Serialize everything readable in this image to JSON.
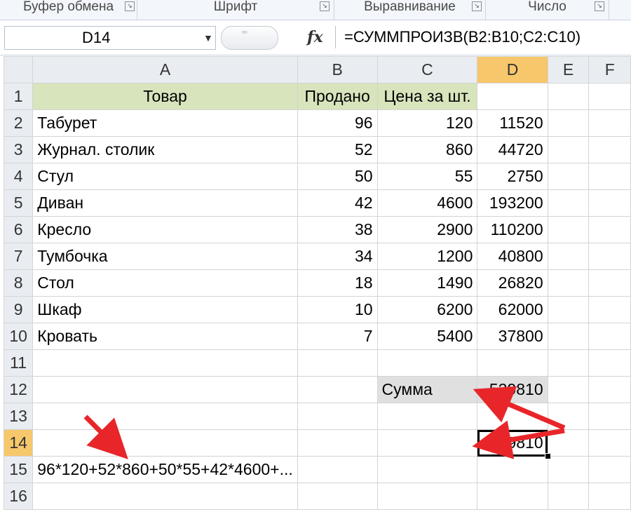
{
  "ribbon": {
    "groups": [
      "Буфер обмена",
      "Шрифт",
      "Выравнивание",
      "Число"
    ]
  },
  "formula_bar": {
    "name_box": "D14",
    "fx_label": "fx",
    "formula": "=СУММПРОИЗВ(B2:B10;C2:C10)"
  },
  "sheet": {
    "columns": [
      "A",
      "B",
      "C",
      "D",
      "E",
      "F"
    ],
    "rows": [
      {
        "n": "1",
        "a": "Товар",
        "b": "Продано",
        "c": "Цена за шт.",
        "d": ""
      },
      {
        "n": "2",
        "a": "Табурет",
        "b": "96",
        "c": "120",
        "d": "11520"
      },
      {
        "n": "3",
        "a": "Журнал. столик",
        "b": "52",
        "c": "860",
        "d": "44720"
      },
      {
        "n": "4",
        "a": "Стул",
        "b": "50",
        "c": "55",
        "d": "2750"
      },
      {
        "n": "5",
        "a": "Диван",
        "b": "42",
        "c": "4600",
        "d": "193200"
      },
      {
        "n": "6",
        "a": "Кресло",
        "b": "38",
        "c": "2900",
        "d": "110200"
      },
      {
        "n": "7",
        "a": "Тумбочка",
        "b": "34",
        "c": "1200",
        "d": "40800"
      },
      {
        "n": "8",
        "a": "Стол",
        "b": "18",
        "c": "1490",
        "d": "26820"
      },
      {
        "n": "9",
        "a": "Шкаф",
        "b": "10",
        "c": "6200",
        "d": "62000"
      },
      {
        "n": "10",
        "a": "Кровать",
        "b": "7",
        "c": "5400",
        "d": "37800"
      },
      {
        "n": "11"
      },
      {
        "n": "12",
        "c": "Сумма",
        "d": "529810"
      },
      {
        "n": "13"
      },
      {
        "n": "14",
        "d": "529810"
      },
      {
        "n": "15",
        "a": "96*120+52*860+50*55+42*4600+..."
      },
      {
        "n": "16"
      }
    ]
  },
  "colors": {
    "header_fill": "#d8e4bc",
    "selected_header": "#f7c76b",
    "sum_fill": "#e0e0e0",
    "arrow": "#e8262a"
  }
}
